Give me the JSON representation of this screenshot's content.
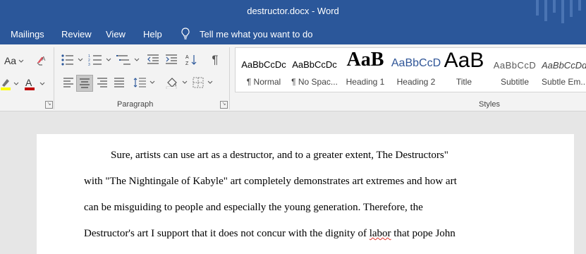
{
  "window": {
    "title": "destructor.docx  -  Word"
  },
  "menu": {
    "mailings": "Mailings",
    "review": "Review",
    "view": "View",
    "help": "Help",
    "tell_me": "Tell me what you want to do"
  },
  "ribbon": {
    "font_group": {
      "change_case": "Aa"
    },
    "paragraph_group": {
      "label": "Paragraph"
    },
    "styles_group": {
      "label": "Styles",
      "items": [
        {
          "sample": "AaBbCcDc",
          "name": "¶ Normal"
        },
        {
          "sample": "AaBbCcDc",
          "name": "¶ No Spac..."
        },
        {
          "sample": "AaB",
          "name": "Heading 1"
        },
        {
          "sample": "AaBbCcD",
          "name": "Heading 2"
        },
        {
          "sample": "AaB",
          "name": "Title"
        },
        {
          "sample": "AaBbCcD",
          "name": "Subtitle"
        },
        {
          "sample": "AaBbCcDd",
          "name": "Subtle Em..."
        }
      ]
    }
  },
  "colors": {
    "titlebar": "#2b579a",
    "highlight": "#ffff00",
    "font_color": "#c00000"
  },
  "document": {
    "lines": [
      "Sure, artists can use art as a destructor, and to a greater extent, The Destructors\"",
      "with \"The Nightingale of Kabyle\" art completely demonstrates art extremes and how art",
      "can be misguiding to people and especially the young generation. Therefore, the"
    ],
    "line4_before": "Destructor's art I support that it does not concur with the dignity of ",
    "line4_flagged": "labor",
    "line4_after": " that pope John"
  }
}
